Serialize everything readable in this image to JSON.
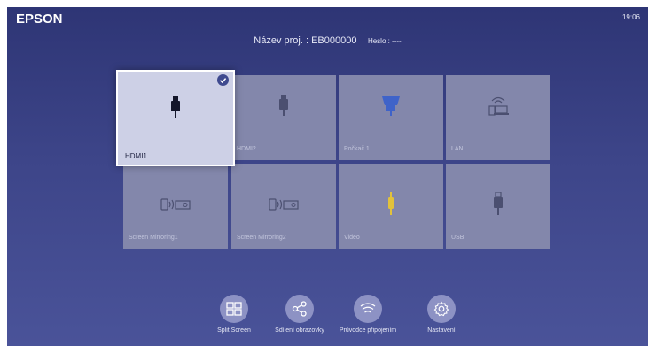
{
  "header": {
    "brand": "EPSON",
    "clock": "19:06",
    "projector_name": "Název proj. : EB000000",
    "password": "Heslo : ----"
  },
  "sources": [
    {
      "label": "HDMI1",
      "icon": "hdmi-icon",
      "selected": true
    },
    {
      "label": "HDMI2",
      "icon": "hdmi-icon",
      "selected": false
    },
    {
      "label": "Počkač 1",
      "icon": "vga-icon",
      "selected": false
    },
    {
      "label": "LAN",
      "icon": "lan-icon",
      "selected": false
    },
    {
      "label": "Screen Mirroring1",
      "icon": "mirroring-icon",
      "selected": false
    },
    {
      "label": "Screen Mirroring2",
      "icon": "mirroring-icon",
      "selected": false
    },
    {
      "label": "Video",
      "icon": "rca-video-icon",
      "selected": false
    },
    {
      "label": "USB",
      "icon": "usb-icon",
      "selected": false
    }
  ],
  "actions": [
    {
      "label": "Split Screen",
      "icon": "split-screen-icon"
    },
    {
      "label": "Sdílení obrazovky",
      "icon": "share-icon"
    },
    {
      "label": "Průvodce připojením",
      "icon": "wifi-icon"
    },
    {
      "label": "Nastavení",
      "icon": "gear-icon"
    }
  ],
  "colors": {
    "background_top": "#2e3575",
    "background_bottom": "#4a5399",
    "tile": "#8387ab",
    "tile_selected": "#cdd0e6",
    "check": "#3f4a8f",
    "vga_connector": "#3f63c9",
    "rca_connector": "#e2c23b",
    "action_circle": "#8d92c4"
  }
}
